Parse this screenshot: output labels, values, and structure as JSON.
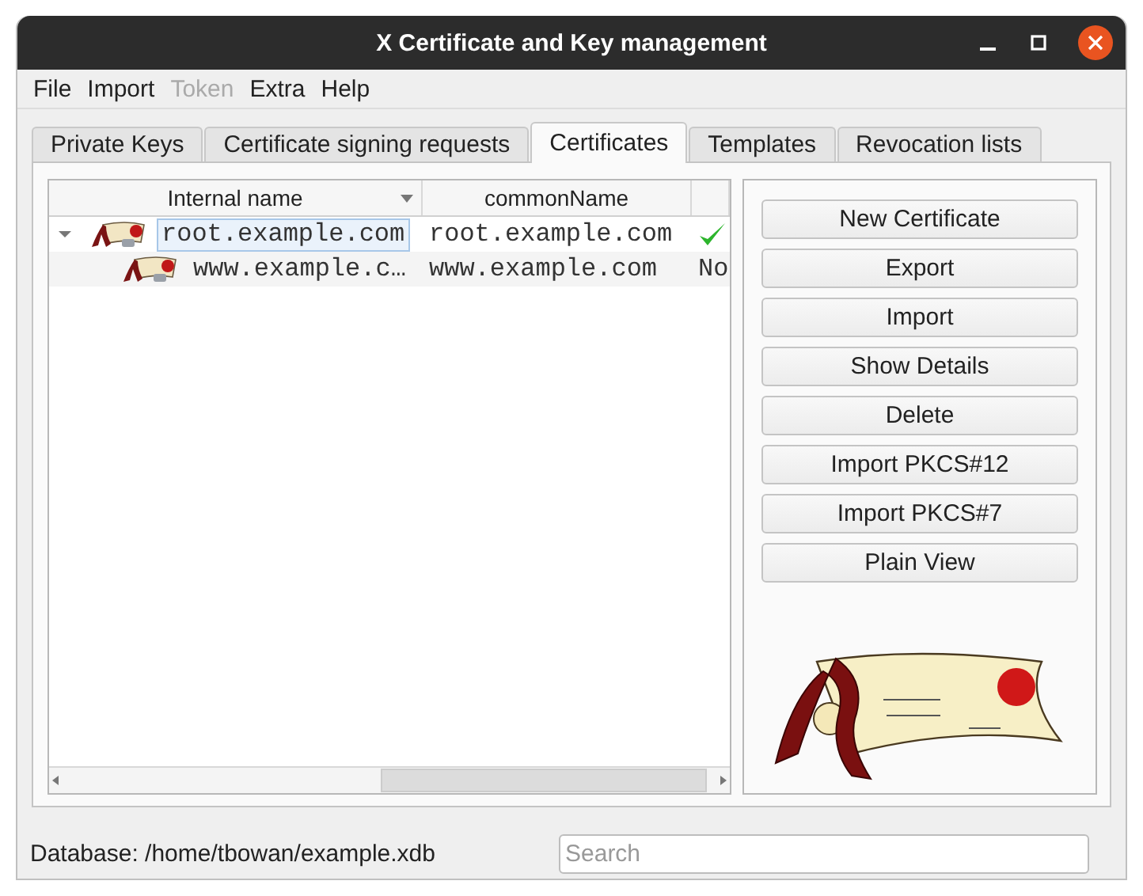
{
  "window": {
    "title": "X Certificate and Key management"
  },
  "menu": [
    {
      "label": "File",
      "disabled": false
    },
    {
      "label": "Import",
      "disabled": false
    },
    {
      "label": "Token",
      "disabled": true
    },
    {
      "label": "Extra",
      "disabled": false
    },
    {
      "label": "Help",
      "disabled": false
    }
  ],
  "tabs": [
    {
      "label": "Private Keys",
      "selected": false
    },
    {
      "label": "Certificate signing requests",
      "selected": false
    },
    {
      "label": "Certificates",
      "selected": true
    },
    {
      "label": "Templates",
      "selected": false
    },
    {
      "label": "Revocation lists",
      "selected": false
    }
  ],
  "tree": {
    "columns": [
      "Internal name",
      "commonName"
    ],
    "rows": [
      {
        "internal_name": "root.example.com",
        "common_name": "root.example.com",
        "column_3": {
          "kind": "check"
        },
        "expanded": true,
        "selected": true,
        "children": [
          {
            "internal_name": "www.example.c…",
            "common_name": "www.example.com",
            "column_3": {
              "kind": "text",
              "text": "No"
            },
            "selected": false
          }
        ]
      }
    ]
  },
  "buttons": [
    "New Certificate",
    "Export",
    "Import",
    "Show Details",
    "Delete",
    "Import PKCS#12",
    "Import PKCS#7",
    "Plain View"
  ],
  "status_bar": {
    "database": "Database: /home/tbowan/example.xdb",
    "search": {
      "placeholder": "Search"
    }
  }
}
